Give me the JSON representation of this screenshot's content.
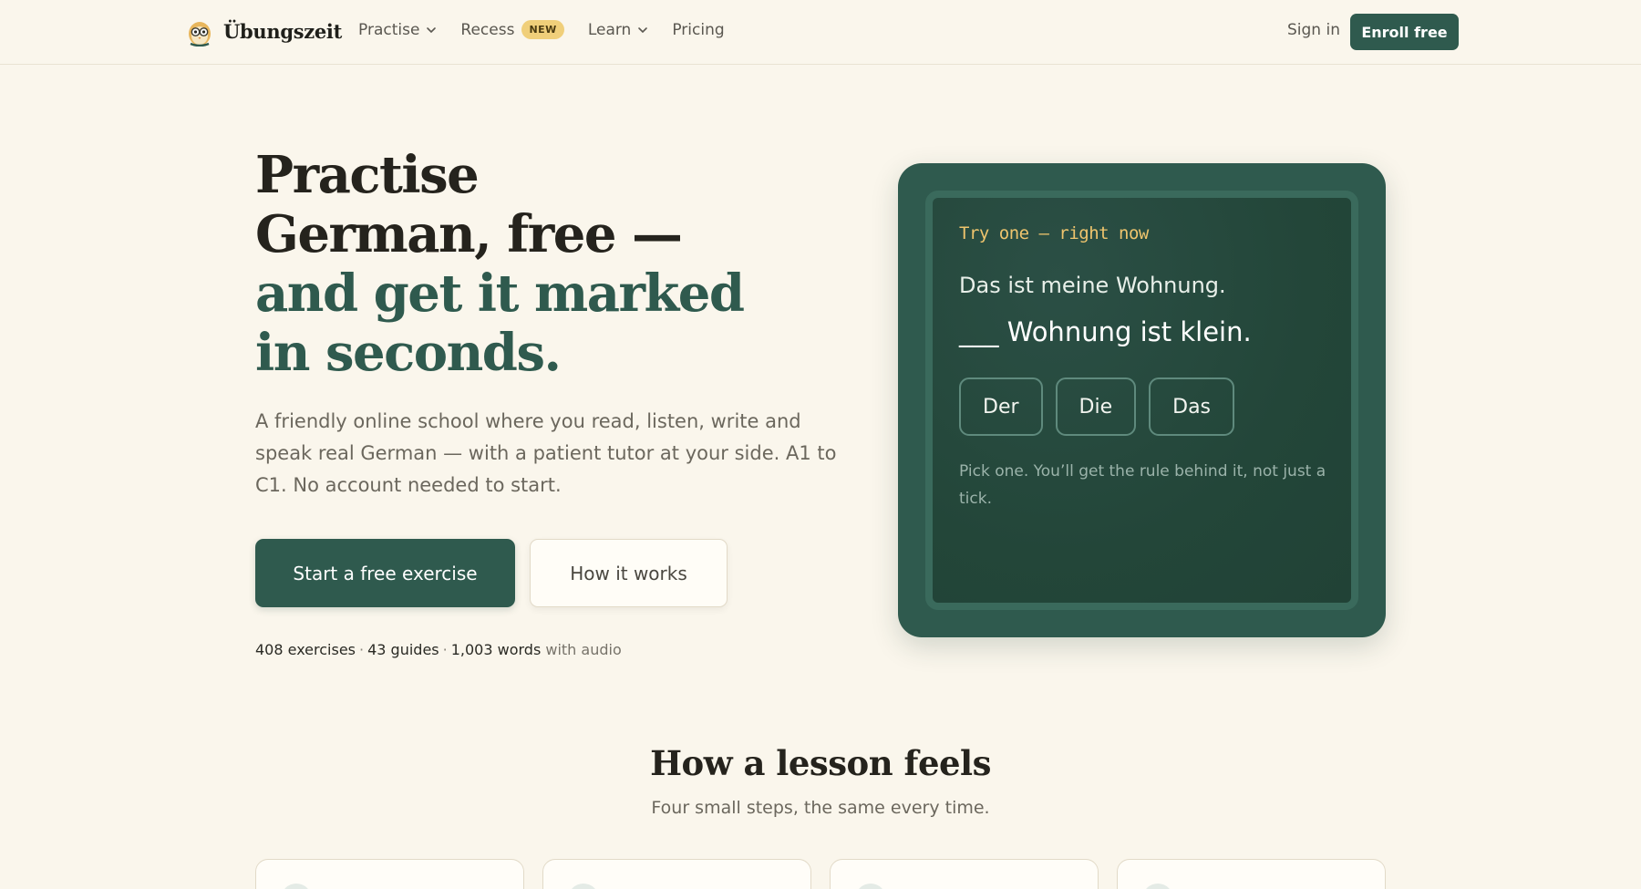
{
  "nav": {
    "brand": "Übungszeit",
    "links": [
      {
        "label": "Practise",
        "has_dropdown": true
      },
      {
        "label": "Recess",
        "badge": "NEW"
      },
      {
        "label": "Learn",
        "has_dropdown": true
      },
      {
        "label": "Pricing"
      }
    ],
    "sign_in": "Sign in",
    "enroll": "Enroll free"
  },
  "hero": {
    "title_line1": "Practise",
    "title_line2": "German, free —",
    "title_accent1": "and get it marked",
    "title_accent2": "in seconds.",
    "subtitle": "A friendly online school where you read, listen, write and speak real German — with a patient tutor at your side. A1 to C1. No account needed to start.",
    "primary_cta": "Start a free exercise",
    "secondary_cta": "How it works",
    "stats": {
      "exercises": "408 exercises",
      "guides": "43 guides",
      "words": "1,003 words",
      "suffix": "with audio"
    }
  },
  "exercise_card": {
    "label": "Try one — right now",
    "sentence1": "Das ist meine Wohnung.",
    "sentence2": "___ Wohnung ist klein.",
    "choices": [
      "Der",
      "Die",
      "Das"
    ],
    "hint": "Pick one. You’ll get the rule behind it, not just a tick."
  },
  "lesson_section": {
    "title": "How a lesson feels",
    "subtitle": "Four small steps, the same every time."
  },
  "colors": {
    "background": "#faf6ec",
    "primary": "#2f5a4e",
    "accent_yellow": "#eec46d",
    "badge": "#f0cf7a"
  }
}
